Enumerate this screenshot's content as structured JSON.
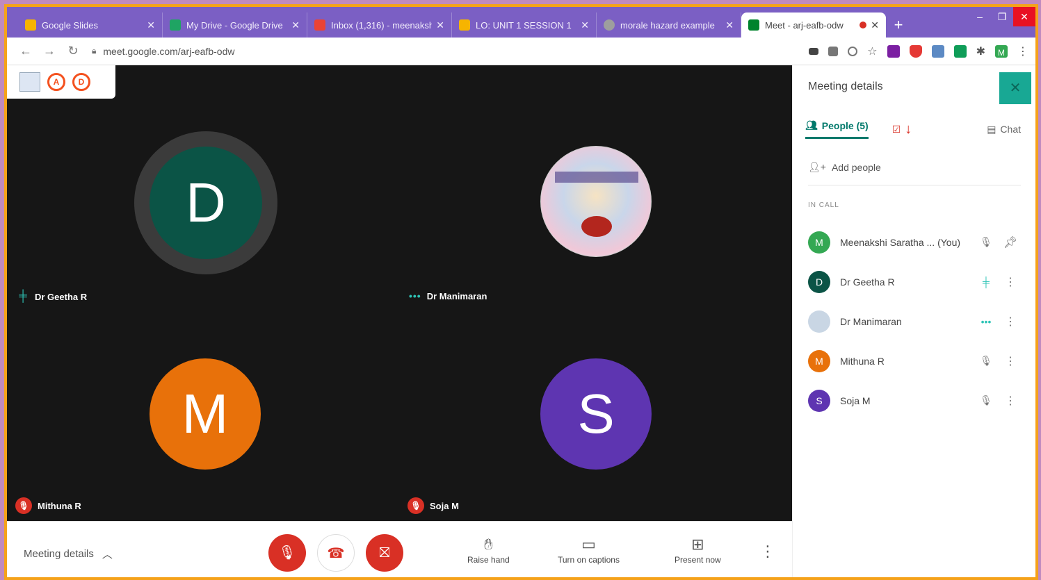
{
  "browser": {
    "tabs": [
      {
        "title": "Google Slides",
        "favicon_color": "#f6b400"
      },
      {
        "title": "My Drive - Google Drive",
        "favicon_color": "#1fa463"
      },
      {
        "title": "Inbox (1,316) - meenakshi",
        "favicon_color": "#ea4335"
      },
      {
        "title": "LO: UNIT 1 SESSION 1 ",
        "favicon_color": "#f6b400"
      },
      {
        "title": "morale hazard example",
        "favicon_color": "#9e9e9e"
      },
      {
        "title": "Meet - arj-eafb-odw",
        "favicon_color": "#00832d"
      }
    ],
    "url": "meet.google.com/arj-eafb-odw",
    "profile_initial": "M"
  },
  "stage": {
    "corner_badges": [
      "A",
      "D"
    ],
    "tiles": [
      {
        "name": "Dr Geetha R",
        "initial": "D",
        "color": "#0b5446",
        "status": "speaking"
      },
      {
        "name": "Dr Manimaran",
        "initial": "",
        "color": "#f0e8d8",
        "status": "dots"
      },
      {
        "name": "Mithuna R",
        "initial": "M",
        "color": "#e8710a",
        "status": "muted"
      },
      {
        "name": "Soja M",
        "initial": "S",
        "color": "#5e35b1",
        "status": "muted"
      }
    ]
  },
  "bottom": {
    "meeting_details": "Meeting details",
    "raise_hand": "Raise hand",
    "captions": "Turn on captions",
    "present": "Present now"
  },
  "panel": {
    "title": "Meeting details",
    "people_tab": "People (5)",
    "chat_tab": "Chat",
    "add_people": "Add people",
    "in_call": "IN CALL",
    "participants": [
      {
        "name": "Meenakshi Saratha ... (You)",
        "initial": "M",
        "color": "#34a853"
      },
      {
        "name": "Dr Geetha R",
        "initial": "D",
        "color": "#0b5446"
      },
      {
        "name": "Dr Manimaran",
        "initial": "",
        "color": "#c9d6e4"
      },
      {
        "name": "Mithuna R",
        "initial": "M",
        "color": "#e8710a"
      },
      {
        "name": "Soja M",
        "initial": "S",
        "color": "#5e35b1"
      }
    ]
  }
}
